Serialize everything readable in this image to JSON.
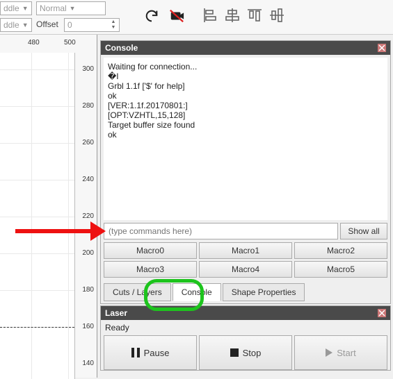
{
  "toolbar": {
    "combo1": "ddle",
    "combo2": "Normal",
    "combo3": "ddle",
    "offset_label": "Offset",
    "offset_value": "0"
  },
  "ruler": {
    "h": [
      "480",
      "500"
    ],
    "v": [
      "300",
      "280",
      "260",
      "240",
      "220",
      "200",
      "180",
      "160",
      "140"
    ]
  },
  "console": {
    "title": "Console",
    "output": "Waiting for connection...\n�I\nGrbl 1.1f ['$' for help]\nok\n[VER:1.1f.20170801:]\n[OPT:VZHTL,15,128]\nTarget buffer size found\nok",
    "input_placeholder": "(type commands here)",
    "show_all": "Show all",
    "macros": [
      "Macro0",
      "Macro1",
      "Macro2",
      "Macro3",
      "Macro4",
      "Macro5"
    ],
    "tabs": {
      "cuts": "Cuts / Layers",
      "console": "Console",
      "shape": "Shape Properties"
    }
  },
  "laser": {
    "title": "Laser",
    "status": "Ready",
    "pause": "Pause",
    "stop": "Stop",
    "start": "Start"
  }
}
